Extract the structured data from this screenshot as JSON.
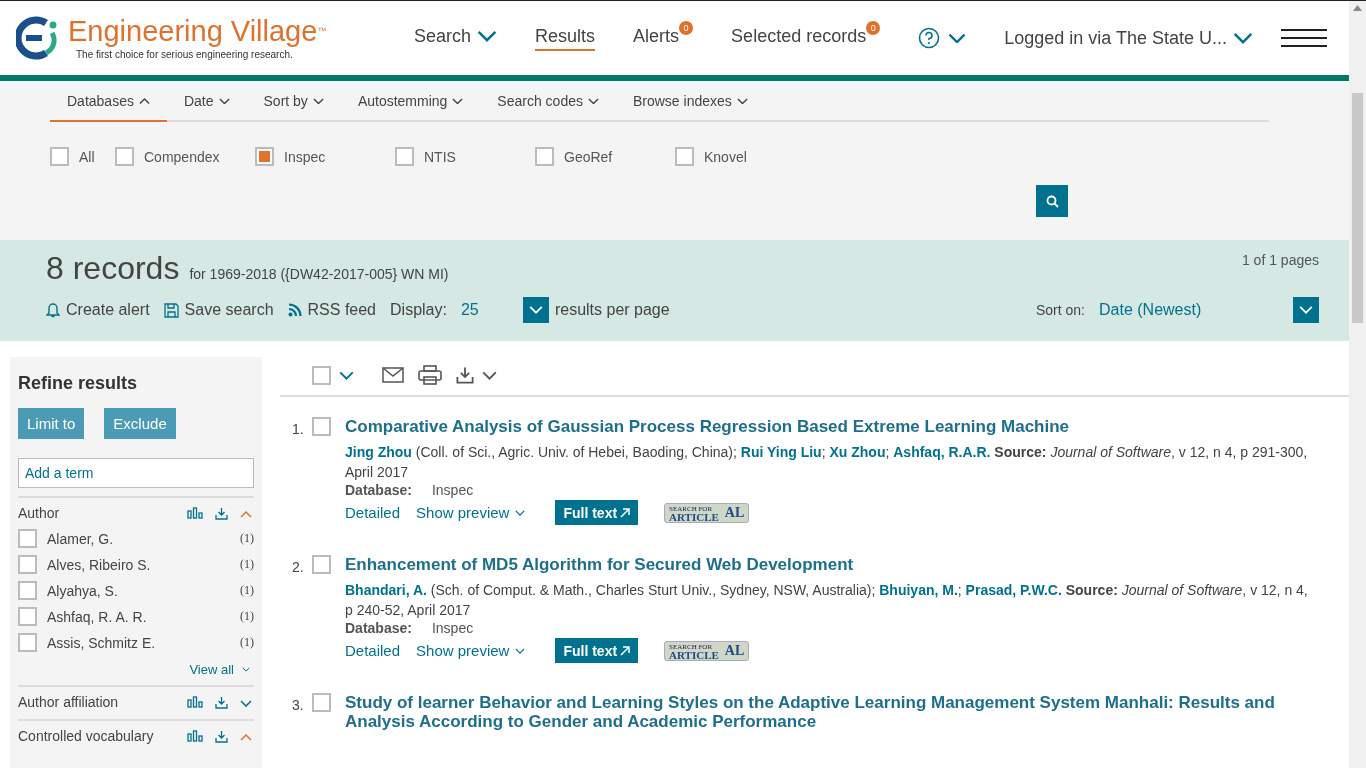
{
  "header": {
    "logo_text": "Engineering Village",
    "logo_mark": "™",
    "tagline": "The first choice for serious engineering research.",
    "nav": [
      {
        "label": "Search",
        "kind": "dropdown",
        "selected": false
      },
      {
        "label": "Results",
        "kind": "link",
        "selected": true
      },
      {
        "label": "Alerts",
        "kind": "badge",
        "badge": "0",
        "selected": false
      },
      {
        "label": "Selected records",
        "kind": "badge",
        "badge": "0",
        "selected": false
      }
    ],
    "user": "Logged in via The State U..."
  },
  "search_tabs": [
    {
      "label": "Databases",
      "expanded": true
    },
    {
      "label": "Date",
      "expanded": false
    },
    {
      "label": "Sort by",
      "expanded": false
    },
    {
      "label": "Autostemming",
      "expanded": false
    },
    {
      "label": "Search codes",
      "expanded": false
    },
    {
      "label": "Browse indexes",
      "expanded": false
    }
  ],
  "databases": [
    {
      "label": "All",
      "checked": false
    },
    {
      "label": "Compendex",
      "checked": false
    },
    {
      "label": "Inspec",
      "checked": true
    },
    {
      "label": "NTIS",
      "checked": false
    },
    {
      "label": "GeoRef",
      "checked": false
    },
    {
      "label": "Knovel",
      "checked": false
    }
  ],
  "summary": {
    "count": "8 records",
    "query": "for 1969-2018 ({DW42-2017-005} WN MI)",
    "pages": "1 of 1 pages",
    "actions": [
      "Create alert",
      "Save search",
      "RSS feed"
    ],
    "display_label": "Display:",
    "display_value": "25",
    "per_page": "results per page",
    "sort_label": "Sort on:",
    "sort_value": "Date (Newest)"
  },
  "refine": {
    "title": "Refine results",
    "buttons": [
      "Limit to",
      "Exclude"
    ],
    "placeholder": "Add a term",
    "facets": [
      {
        "name": "Author",
        "expanded": true,
        "items": [
          {
            "label": "Alamer, G.",
            "count": "(1)",
            "checked": false
          },
          {
            "label": "Alves, Ribeiro S.",
            "count": "(1)",
            "checked": false
          },
          {
            "label": "Alyahya, S.",
            "count": "(1)",
            "checked": false
          },
          {
            "label": "Ashfaq, R. A. R.",
            "count": "(1)",
            "checked": false
          },
          {
            "label": "Assis, Schmitz E.",
            "count": "(1)",
            "checked": false
          }
        ],
        "view_all": "View all"
      },
      {
        "name": "Author affiliation",
        "expanded": false
      },
      {
        "name": "Controlled vocabulary",
        "expanded": true
      }
    ]
  },
  "select_all": {
    "checked": false
  },
  "results": [
    {
      "number": "1.",
      "checked": false,
      "title": "Comparative Analysis of Gaussian Process Regression Based Extreme Learning Machine",
      "authors": [
        {
          "name": "Jing Zhou",
          "affiliation": "(Coll. of Sci., Agric. Univ. of Hebei, Baoding, China)",
          "sep": ";"
        },
        {
          "name": "Rui Ying Liu",
          "sep": ";"
        },
        {
          "name": "Xu Zhou",
          "sep": ";"
        },
        {
          "name": "Ashfaq, R.A.R."
        }
      ],
      "source_label": "Source:",
      "journal": "Journal of Software",
      "source_detail": ", v 12, n 4, p 291-300, April 2017",
      "database_label": "Database:",
      "database": "Inspec",
      "links": [
        "Detailed",
        "Show preview"
      ],
      "full_text": "Full text",
      "article_top": "SEARCH FOR",
      "article_bottom": "ARTICLE",
      "article_logo": "AL"
    },
    {
      "number": "2.",
      "checked": false,
      "title": "Enhancement of MD5 Algorithm for Secured Web Development",
      "authors": [
        {
          "name": "Bhandari, A.",
          "affiliation": "(Sch. of Comput. & Math., Charles Sturt Univ., Sydney, NSW, Australia)",
          "sep": ";"
        },
        {
          "name": "Bhuiyan, M.",
          "sep": ";"
        },
        {
          "name": "Prasad, P.W.C."
        }
      ],
      "source_label": "Source:",
      "journal": "Journal of Software",
      "source_detail": ", v 12, n 4, p 240-52, April 2017",
      "database_label": "Database:",
      "database": "Inspec",
      "links": [
        "Detailed",
        "Show preview"
      ],
      "full_text": "Full text",
      "article_top": "SEARCH FOR",
      "article_bottom": "ARTICLE",
      "article_logo": "AL"
    },
    {
      "number": "3.",
      "checked": false,
      "title": "Study of learner Behavior and Learning Styles on the Adaptive Learning Management System Manhali: Results and Analysis According to Gender and Academic Performance"
    }
  ]
}
